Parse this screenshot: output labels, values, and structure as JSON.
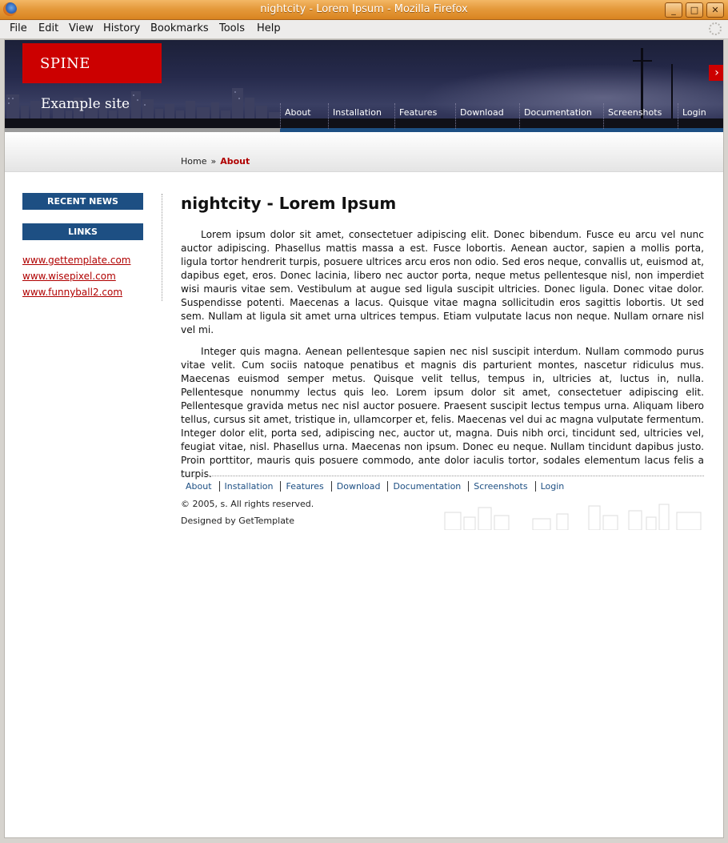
{
  "window": {
    "title": "nightcity - Lorem Ipsum - Mozilla Firefox"
  },
  "menu": [
    "File",
    "Edit",
    "View",
    "History",
    "Bookmarks",
    "Tools",
    "Help"
  ],
  "header": {
    "logo": "SPINE",
    "site_name": "Example site",
    "nav": [
      "About",
      "Installation",
      "Features",
      "Download",
      "Documentation",
      "Screenshots",
      "Login"
    ]
  },
  "breadcrumb": {
    "home": "Home",
    "separator": "»",
    "current": "About"
  },
  "sidebar": {
    "recent_news": "RECENT NEWS",
    "links_title": "LINKS",
    "links": [
      "www.gettemplate.com",
      "www.wisepixel.com",
      "www.funnyball2.com"
    ]
  },
  "main": {
    "title": "nightcity - Lorem Ipsum",
    "paragraphs": [
      "Lorem ipsum dolor sit amet, consectetuer adipiscing elit. Donec bibendum. Fusce eu arcu vel nunc auctor adipiscing. Phasellus mattis massa a est. Fusce lobortis. Aenean auctor, sapien a mollis porta, ligula tortor hendrerit turpis, posuere ultrices arcu eros non odio. Sed eros neque, convallis ut, euismod at, dapibus eget, eros. Donec lacinia, libero nec auctor porta, neque metus pellentesque nisl, non imperdiet wisi mauris vitae sem. Vestibulum at augue sed ligula suscipit ultricies. Donec ligula. Donec vitae dolor. Suspendisse potenti. Maecenas a lacus. Quisque vitae magna sollicitudin eros sagittis lobortis. Ut sed sem. Nullam at ligula sit amet urna ultrices tempus. Etiam vulputate lacus non neque. Nullam ornare nisl vel mi.",
      "Integer quis magna. Aenean pellentesque sapien nec nisl suscipit interdum. Nullam commodo purus vitae velit. Cum sociis natoque penatibus et magnis dis parturient montes, nascetur ridiculus mus. Maecenas euismod semper metus. Quisque velit tellus, tempus in, ultricies at, luctus in, nulla. Pellentesque nonummy lectus quis leo. Lorem ipsum dolor sit amet, consectetuer adipiscing elit. Pellentesque gravida metus nec nisl auctor posuere. Praesent suscipit lectus tempus urna. Aliquam libero tellus, cursus sit amet, tristique in, ullamcorper et, felis. Maecenas vel dui ac magna vulputate fermentum. Integer dolor elit, porta sed, adipiscing nec, auctor ut, magna. Duis nibh orci, tincidunt sed, ultricies vel, feugiat vitae, nisl. Phasellus urna. Maecenas non ipsum. Donec eu neque. Nullam tincidunt dapibus justo. Proin porttitor, mauris quis posuere commodo, ante dolor iaculis tortor, sodales elementum lacus felis a turpis."
    ]
  },
  "footer": {
    "nav": [
      "About",
      "Installation",
      "Features",
      "Download",
      "Documentation",
      "Screenshots",
      "Login"
    ],
    "copyright": "© 2005, s. All rights reserved.",
    "designed_by": "Designed by GetTemplate"
  },
  "colors": {
    "accent_red": "#cc0000",
    "nav_blue": "#1d4f83",
    "link_red": "#b00000"
  }
}
